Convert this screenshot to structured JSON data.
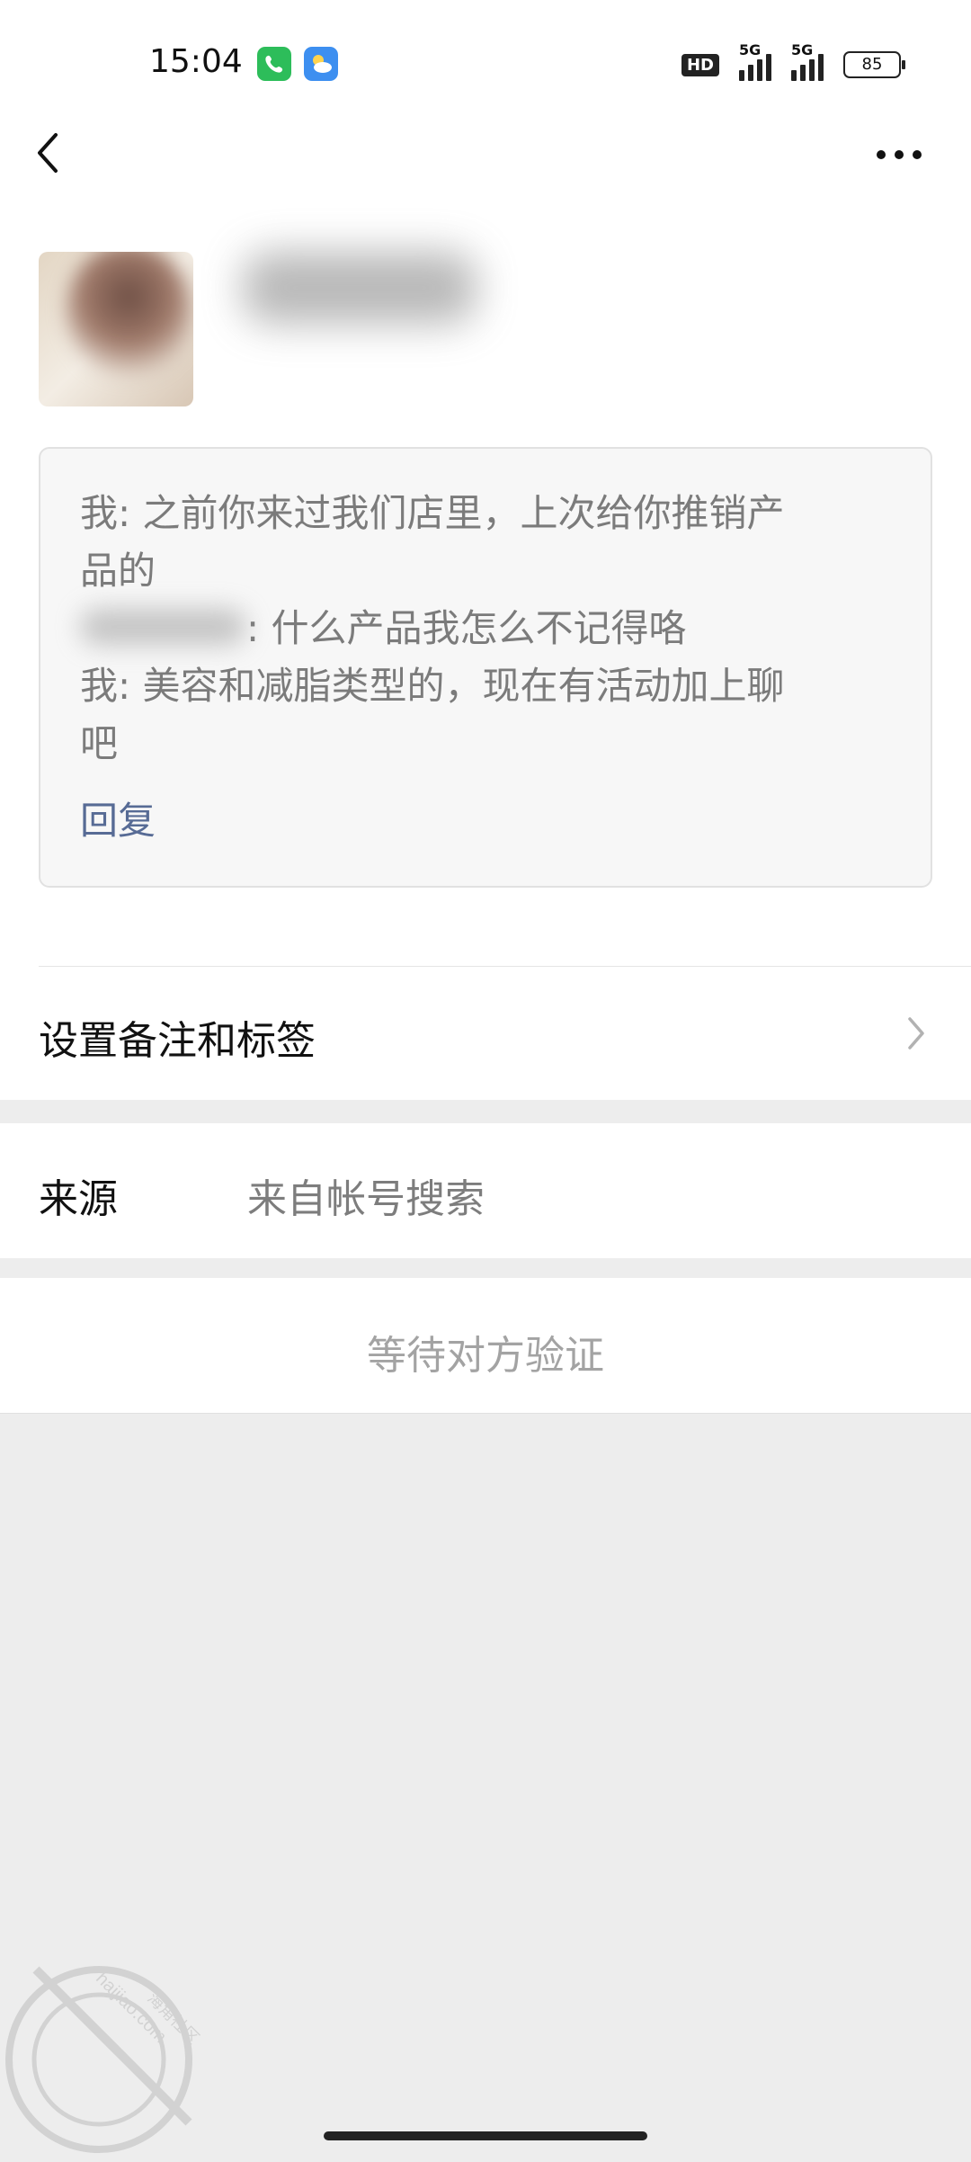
{
  "status_bar": {
    "time": "15:04",
    "network_badge": "HD",
    "signal_1_label": "5G",
    "signal_2_label": "5G",
    "battery": "85"
  },
  "message_card": {
    "line1": "我: 之前你来过我们店里，上次给你推销产",
    "line2": "品的",
    "line3_text": ": 什么产品我怎么不记得咯",
    "line4": "我: 美容和减脂类型的，现在有活动加上聊",
    "line5": "吧",
    "reply_label": "回复"
  },
  "remark_row": {
    "label": "设置备注和标签"
  },
  "source_row": {
    "label": "来源",
    "value": "来自帐号搜索"
  },
  "pending_row": {
    "label": "等待对方验证"
  },
  "watermark": {
    "site": "haijiao.com",
    "site_cn": "海角社区"
  },
  "colors": {
    "link": "#576b95",
    "background": "#ededed",
    "card_bg": "#f7f7f7",
    "call_app": "#2dbd5a",
    "weather_app": "#3d8ff0"
  }
}
